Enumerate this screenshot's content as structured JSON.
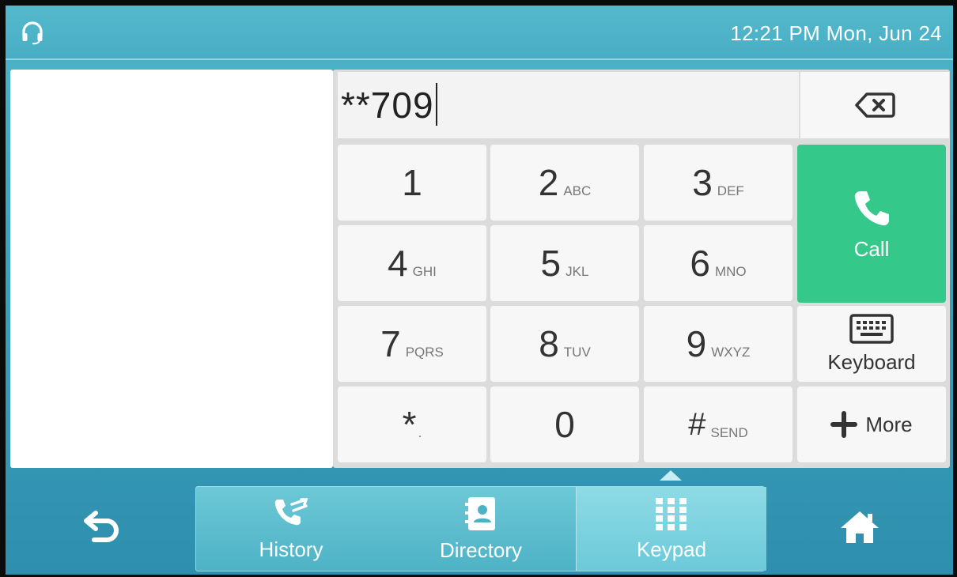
{
  "status": {
    "clock": "12:21 PM Mon, Jun 24",
    "left_icon": "headset-icon"
  },
  "dialer": {
    "number": "**709",
    "backspace_icon": "backspace-icon"
  },
  "keys": [
    {
      "digit": "1",
      "letters": ""
    },
    {
      "digit": "2",
      "letters": "ABC"
    },
    {
      "digit": "3",
      "letters": "DEF"
    },
    {
      "digit": "4",
      "letters": "GHI"
    },
    {
      "digit": "5",
      "letters": "JKL"
    },
    {
      "digit": "6",
      "letters": "MNO"
    },
    {
      "digit": "7",
      "letters": "PQRS"
    },
    {
      "digit": "8",
      "letters": "TUV"
    },
    {
      "digit": "9",
      "letters": "WXYZ"
    },
    {
      "digit": "*",
      "letters": "."
    },
    {
      "digit": "0",
      "letters": ""
    },
    {
      "digit": "#",
      "letters": "SEND"
    }
  ],
  "actions": {
    "call": "Call",
    "keyboard": "Keyboard",
    "more": "More"
  },
  "tabs": [
    {
      "label": "History",
      "icon": "history-icon"
    },
    {
      "label": "Directory",
      "icon": "directory-icon"
    },
    {
      "label": "Keypad",
      "icon": "keypad-icon",
      "active": true
    }
  ],
  "nav": {
    "back_icon": "back-icon",
    "home_icon": "home-icon"
  },
  "colors": {
    "call_green": "#34c98a",
    "screen_blue": "#3aa2bb"
  }
}
